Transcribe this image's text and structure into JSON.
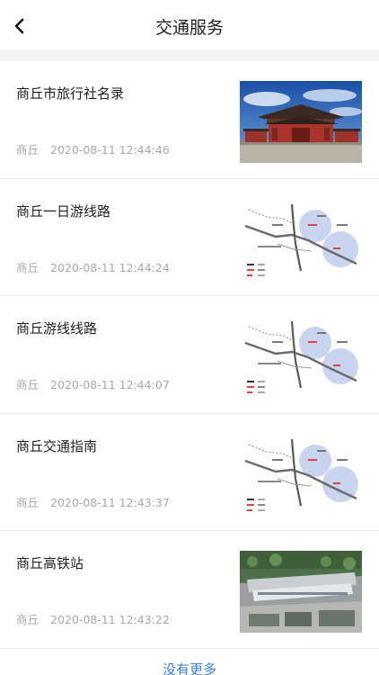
{
  "header": {
    "title": "交通服务",
    "back_icon": "chevron-left-icon"
  },
  "items": [
    {
      "title": "商丘市旅行社名录",
      "source": "商丘",
      "time": "2020-08-11 12:44:46",
      "thumb": "temple-photo"
    },
    {
      "title": "商丘一日游线路",
      "source": "商丘",
      "time": "2020-08-11 12:44:24",
      "thumb": "route-map"
    },
    {
      "title": "商丘游线线路",
      "source": "商丘",
      "time": "2020-08-11 12:44:07",
      "thumb": "route-map"
    },
    {
      "title": "商丘交通指南",
      "source": "商丘",
      "time": "2020-08-11 12:43:37",
      "thumb": "route-map"
    },
    {
      "title": "商丘高铁站",
      "source": "商丘",
      "time": "2020-08-11 12:43:22",
      "thumb": "station-aerial-photo"
    }
  ],
  "footer": {
    "no_more": "没有更多"
  },
  "colors": {
    "link": "#3a7fd5",
    "meta": "#a8a8a8",
    "divider": "#ececec"
  }
}
